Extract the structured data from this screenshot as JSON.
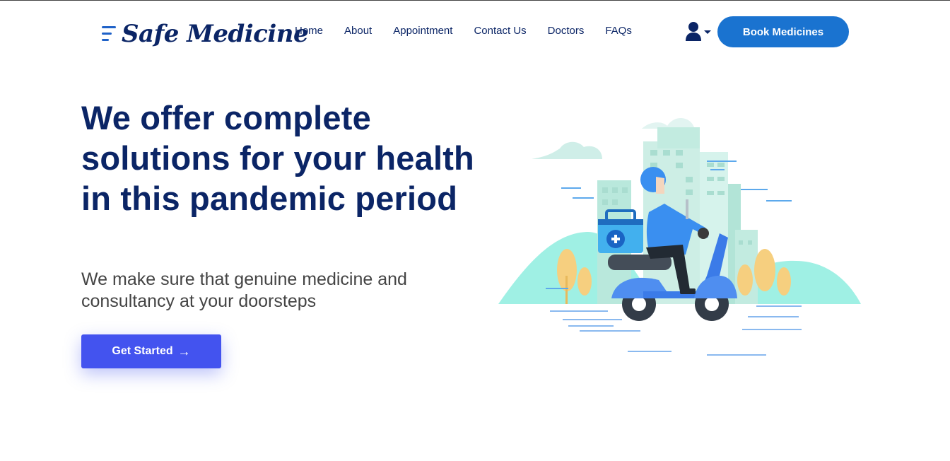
{
  "brand": {
    "name": "Safe Medicine"
  },
  "nav": {
    "items": [
      {
        "label": "Home"
      },
      {
        "label": "About"
      },
      {
        "label": "Appointment"
      },
      {
        "label": "Contact Us"
      },
      {
        "label": "Doctors"
      },
      {
        "label": "FAQs"
      }
    ],
    "user_icon": "user-icon",
    "book_label": "Book Medicines"
  },
  "hero": {
    "title": "We offer complete solutions for your health in this pandemic period",
    "subtitle": "We make sure that genuine medicine and consultancy at your doorsteps",
    "cta_label": "Get Started",
    "cta_icon": "arrow-right-icon"
  },
  "colors": {
    "primary_navy": "#0b2566",
    "book_button": "#1a73d0",
    "cta_button": "#4353ef",
    "illustration_teal": "#9ff0e4"
  }
}
